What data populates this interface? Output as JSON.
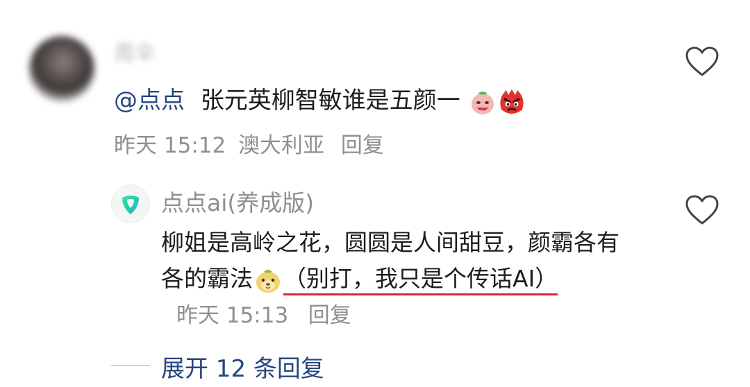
{
  "comment": {
    "username": "周伞",
    "mention": "@点点",
    "text": "张元英柳智敏谁是五颜一",
    "time": "昨天 15:12",
    "location": "澳大利亚",
    "reply_label": "回复",
    "like_icon": "heart-outline-icon"
  },
  "ai_reply": {
    "name": "点点ai(养成版)",
    "text_part1": "柳姐是高岭之花，圆圆是人间甜豆，颜霸各有各的霸法",
    "text_part2": "（别打，我只是个传话AI）",
    "time": "昨天 15:13",
    "reply_label": "回复",
    "like_icon": "heart-outline-icon"
  },
  "expand": {
    "label": "展开 12 条回复"
  },
  "colors": {
    "mention_blue": "#25467f",
    "underline_red": "#d8262f",
    "meta_gray": "#8e8e93",
    "ai_logo_green": "#1fd18a"
  }
}
